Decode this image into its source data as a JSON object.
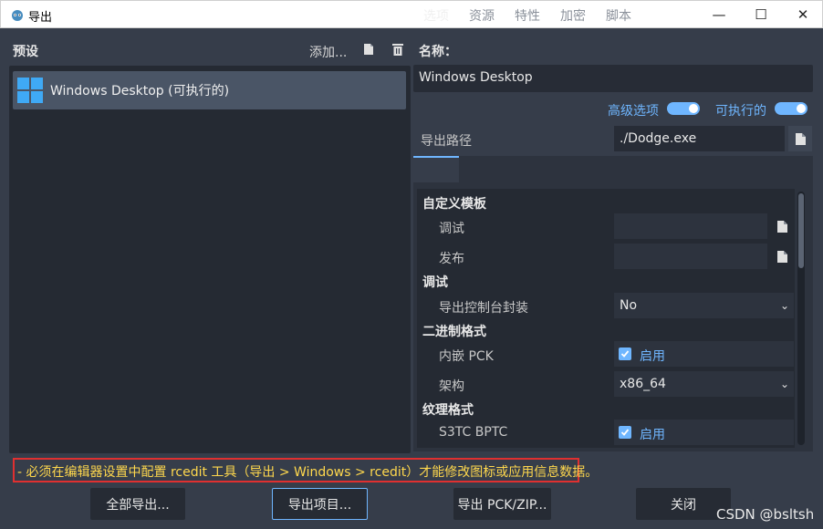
{
  "window": {
    "title": "导出",
    "minimize": "—",
    "maximize": "☐",
    "close": "✕"
  },
  "presets": {
    "label": "预设",
    "add_label": "添加...",
    "items": [
      {
        "label": "Windows Desktop (可执行的)",
        "icon": "windows-logo-icon"
      }
    ]
  },
  "details": {
    "name_label": "名称：",
    "name_value": "Windows Desktop",
    "advanced_label": "高级选项",
    "executable_label": "可执行的",
    "export_path_label": "导出路径",
    "export_path_value": "./Dodge.exe",
    "tabs": [
      "选项",
      "资源",
      "特性",
      "加密",
      "脚本"
    ],
    "active_tab": "选项",
    "sections": {
      "custom_template": "自定义模板",
      "debug": "调试",
      "binary_format": "二进制格式",
      "texture_format": "纹理格式"
    },
    "props": {
      "template_debug": "调试",
      "template_release": "发布",
      "export_console": "导出控制台封装",
      "export_console_value": "No",
      "embed_pck": "内嵌 PCK",
      "enabled": "启用",
      "architecture": "架构",
      "architecture_value": "x86_64",
      "s3tc_bptc": "S3TC BPTC"
    }
  },
  "warning": "- 必须在编辑器设置中配置 rcedit 工具（导出 > Windows > rcedit）才能修改图标或应用信息数据。",
  "buttons": {
    "export_all": "全部导出...",
    "export_project": "导出项目...",
    "export_pck": "导出 PCK/ZIP...",
    "close": "关闭"
  },
  "watermark": "CSDN @bsltsh",
  "colors": {
    "accent": "#6fb6ff",
    "warning_text": "#ffd84d",
    "highlight_border": "#e03030",
    "background": "#363d4a"
  }
}
